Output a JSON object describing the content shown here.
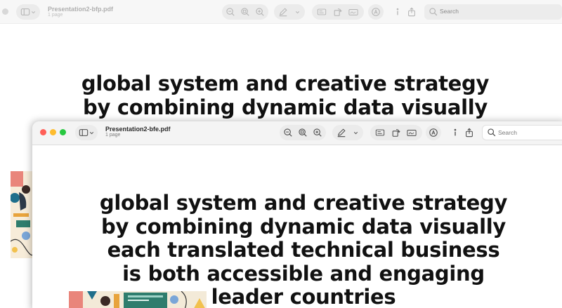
{
  "back_window": {
    "title": "Presentation2-bfp.pdf",
    "pages": "1 page",
    "search_placeholder": "Search",
    "slide_lines": [
      "global system and creative strategy",
      "by combining dynamic data visually"
    ]
  },
  "front_window": {
    "title": "Presentation2-bfe.pdf",
    "pages": "1 page",
    "search_placeholder": "Search",
    "slide_lines": [
      "global system and creative strategy",
      "by combining dynamic data visually",
      "each translated technical business",
      "is both accessible and engaging",
      "leader countries"
    ]
  },
  "toolbar_icons": [
    "sidebar-icon",
    "chevron-down-icon",
    "zoom-out-icon",
    "zoom-fit-icon",
    "zoom-in-icon",
    "markup-pen-icon",
    "chevron-down-icon",
    "textbox-icon",
    "rotate-icon",
    "signature-icon",
    "accessibility-icon",
    "info-icon",
    "share-icon",
    "search-icon"
  ],
  "colors": {
    "close": "#ff5f57",
    "minimize": "#febc2e",
    "zoom": "#28c840",
    "inactive_dot": "#d8d8d8"
  }
}
